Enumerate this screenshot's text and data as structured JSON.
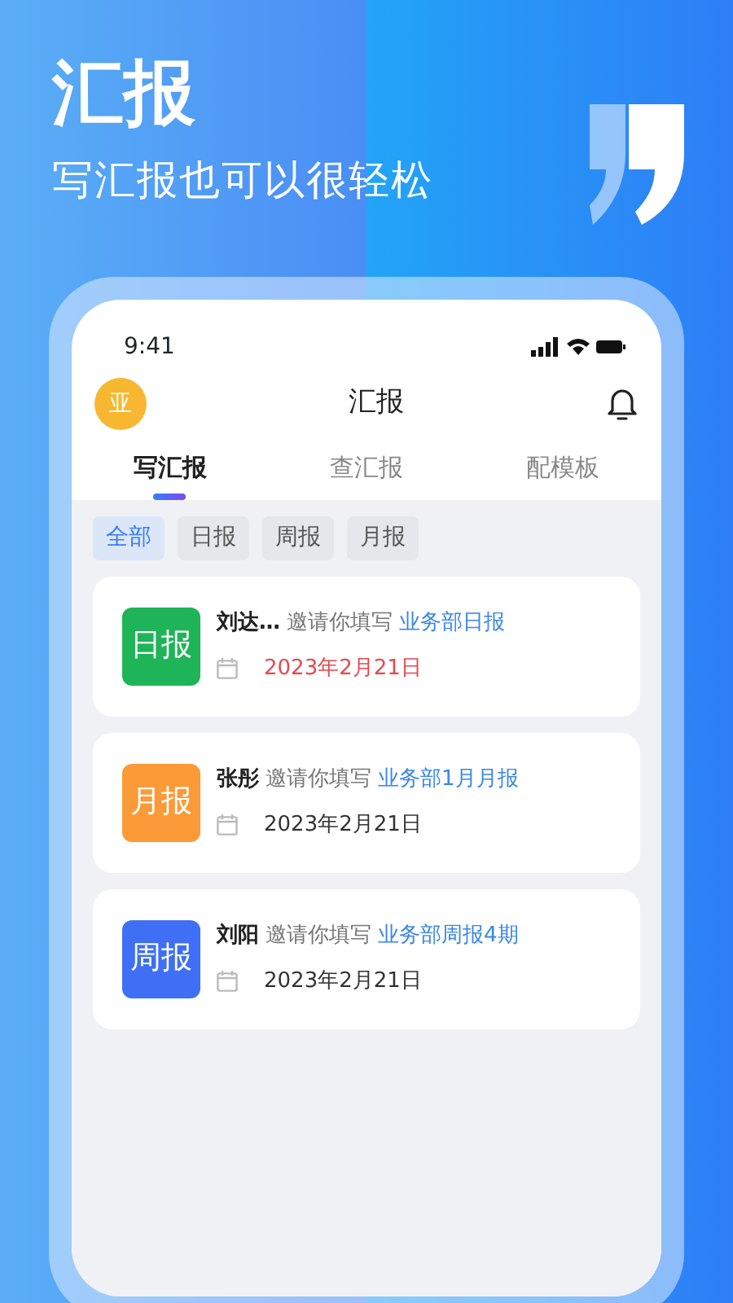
{
  "headline": "汇报",
  "subheadline": "写汇报也可以很轻松",
  "status_bar": {
    "time": "9:41"
  },
  "header": {
    "avatar": "亚",
    "title": "汇报"
  },
  "tabs": [
    {
      "label": "写汇报",
      "selected": true
    },
    {
      "label": "查汇报",
      "selected": false
    },
    {
      "label": "配模板",
      "selected": false
    }
  ],
  "filters": [
    {
      "label": "全部",
      "selected": true
    },
    {
      "label": "日报",
      "selected": false
    },
    {
      "label": "周报",
      "selected": false
    },
    {
      "label": "月报",
      "selected": false
    }
  ],
  "reports": [
    {
      "badge": "日报",
      "color": "#1fb457",
      "name": "刘达…",
      "invite": "邀请你填写",
      "report": "业务部日报",
      "date": "2023年2月21日",
      "overdue": true
    },
    {
      "badge": "月报",
      "color": "#fb9a36",
      "name": "张彤",
      "invite": "邀请你填写",
      "report": "业务部1月月报",
      "date": "2023年2月21日",
      "overdue": false
    },
    {
      "badge": "周报",
      "color": "#3e6ff5",
      "name": "刘阳",
      "invite": "邀请你填写",
      "report": "业务部周报4期",
      "date": "2023年2月21日",
      "overdue": false
    }
  ]
}
